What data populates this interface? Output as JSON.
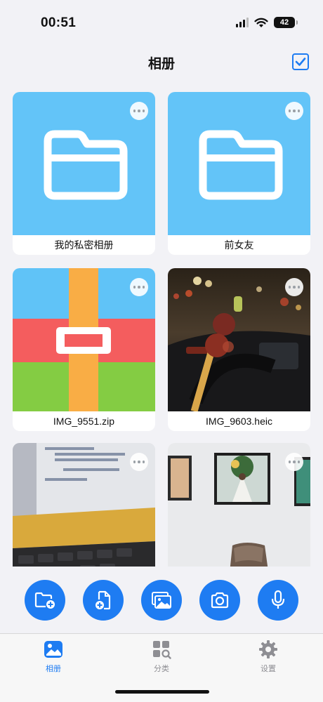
{
  "status_bar": {
    "time": "00:51",
    "battery": "42"
  },
  "header": {
    "title": "相册"
  },
  "albums": [
    {
      "name": "我的私密相册",
      "kind": "folder-icon"
    },
    {
      "name": "前女友",
      "kind": "folder-icon"
    },
    {
      "name": "IMG_9551.zip",
      "kind": "zip-icon"
    },
    {
      "name": "IMG_9603.heic",
      "kind": "photo"
    },
    {
      "name": "",
      "kind": "photo"
    },
    {
      "name": "",
      "kind": "photo"
    }
  ],
  "tabs": [
    {
      "label": "相册",
      "active": true
    },
    {
      "label": "分类",
      "active": false
    },
    {
      "label": "设置",
      "active": false
    }
  ],
  "colors": {
    "accent": "#1e7cf2",
    "folder": "#63c4f8"
  }
}
